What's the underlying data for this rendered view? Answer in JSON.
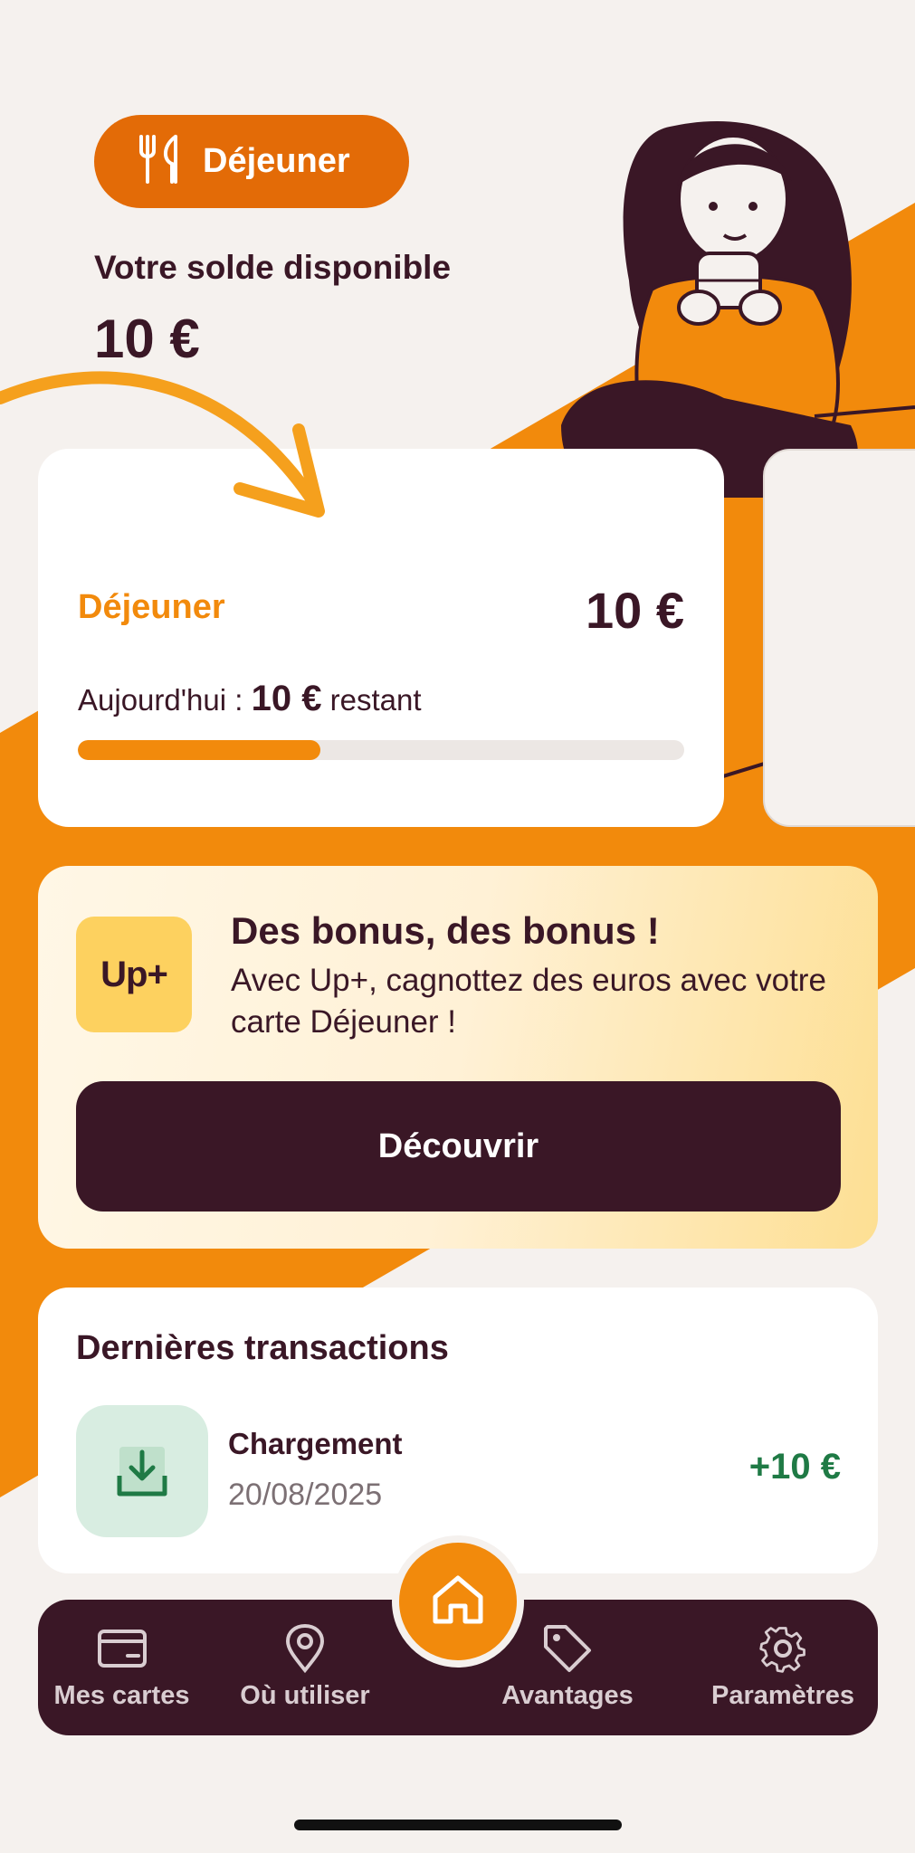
{
  "theme": {
    "accent": "#F28A0C",
    "pill": "#E36B07",
    "dark": "#3A1726",
    "background": "#F5F1EE",
    "positive": "#1F7A45"
  },
  "header": {
    "meal_pill": {
      "icon": "fork-knife-icon",
      "label": "Déjeuner"
    },
    "balance_caption": "Votre solde disponible",
    "balance_amount": "10 €"
  },
  "wallet_card": {
    "title": "Déjeuner",
    "amount": "10 €",
    "today_prefix": "Aujourd'hui :",
    "today_amount": "10 €",
    "today_suffix": "restant",
    "progress_fraction": 0.4
  },
  "promo": {
    "badge": "Up+",
    "title": "Des bonus, des bonus !",
    "text": "Avec Up+, cagnottez des euros avec votre carte Déjeuner !",
    "cta": "Découvrir"
  },
  "transactions": {
    "title": "Dernières transactions",
    "items": [
      {
        "icon": "download-icon",
        "label": "Chargement",
        "date": "20/08/2025",
        "amount": "+10 €"
      }
    ]
  },
  "navbar": {
    "items": [
      {
        "icon": "card-icon",
        "label": "Mes cartes"
      },
      {
        "icon": "location-pin-icon",
        "label": "Où utiliser"
      },
      {
        "icon": "home-icon",
        "label": ""
      },
      {
        "icon": "tag-icon",
        "label": "Avantages"
      },
      {
        "icon": "gear-icon",
        "label": "Paramètres"
      }
    ]
  }
}
